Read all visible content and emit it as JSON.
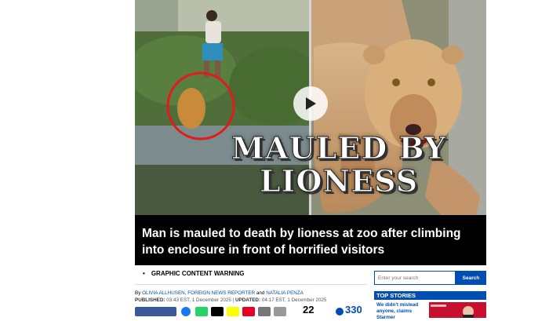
{
  "video": {
    "overlay_line1": "MAULED BY",
    "overlay_line2": "LIONESS",
    "headline": "Man is mauled to death by lioness at zoo after climbing into enclosure in front of horrified visitors"
  },
  "article": {
    "warning": "GRAPHIC CONTENT WARNING",
    "by": "By",
    "author1": "OLIVIA ALLHUSEN, FOREIGN NEWS REPORTER",
    "and": "and",
    "author2": "NATALIA PENZA",
    "published_label": "PUBLISHED:",
    "published": "03:43 EST, 1 December 2025",
    "updated_label": "UPDATED:",
    "updated": "04:17 EST, 1 December 2025",
    "share_count": "22",
    "comment_count": "330"
  },
  "sidebar": {
    "search_placeholder": "Enter your search",
    "search_button": "Search",
    "top_stories": "TOP STORIES",
    "story1": "We didn't mislead anyone, claims Starmer"
  },
  "colors": {
    "brand_blue": "#004db3",
    "red_circle": "#e21b1b"
  }
}
